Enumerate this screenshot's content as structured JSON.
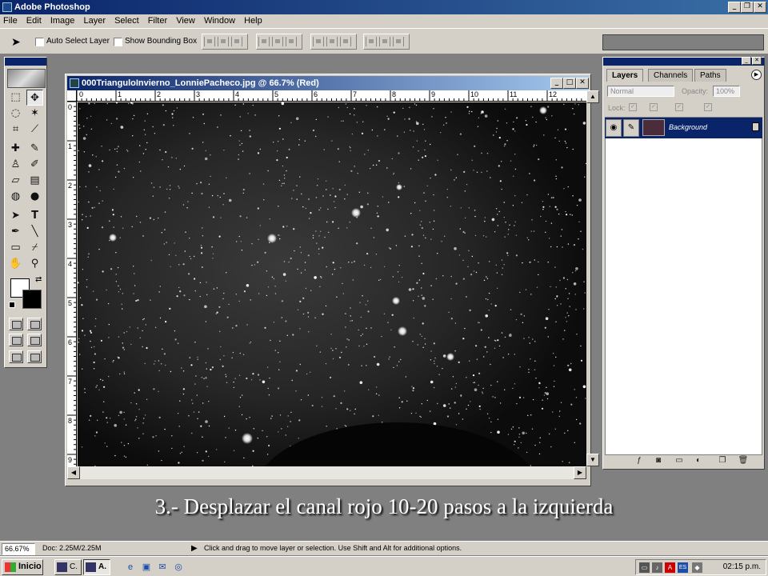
{
  "app": {
    "title": "Adobe Photoshop"
  },
  "menu": [
    "File",
    "Edit",
    "Image",
    "Layer",
    "Select",
    "Filter",
    "View",
    "Window",
    "Help"
  ],
  "options_bar": {
    "auto_select_label": "Auto Select Layer",
    "show_bounding_box_label": "Show Bounding Box"
  },
  "document": {
    "title": "000TrianguloInvierno_LonniePacheco.jpg @ 66.7% (Red)",
    "ruler_h_labels": [
      "0",
      "1",
      "2",
      "3",
      "4",
      "5",
      "6",
      "7",
      "8",
      "9",
      "10",
      "11",
      "12"
    ],
    "ruler_v_labels": [
      "0",
      "1",
      "2",
      "3",
      "4",
      "5",
      "6",
      "7",
      "8",
      "9"
    ]
  },
  "layers_panel": {
    "tabs": [
      "Layers",
      "Channels",
      "Paths"
    ],
    "blend_mode": "Normal",
    "opacity_label": "Opacity:",
    "opacity_value": "100%",
    "lock_label": "Lock:",
    "layer_name": "Background"
  },
  "caption": "3.- Desplazar el canal rojo 10-20 pasos a la izquierda",
  "status": {
    "zoom": "66.67%",
    "doc": "Doc: 2.25M/2.25M",
    "hint": "Click and drag to move layer or selection.  Use Shift and Alt for additional options."
  },
  "taskbar": {
    "start_label": "Inicio",
    "tasks": [
      "C.",
      "A."
    ],
    "tray_lang": "ES",
    "clock": "02:15 p.m."
  },
  "colors": {
    "titlebar": "#0a246a",
    "chrome": "#d4d0c8",
    "workspace": "#808080",
    "canvas": "#101010"
  },
  "icons": {
    "toolbox": [
      "marquee-icon",
      "move-icon",
      "lasso-icon",
      "magic-wand-icon",
      "crop-icon",
      "slice-icon",
      "healing-brush-icon",
      "brush-icon",
      "clone-stamp-icon",
      "history-brush-icon",
      "eraser-icon",
      "gradient-icon",
      "blur-icon",
      "dodge-icon",
      "path-select-icon",
      "type-icon",
      "pen-icon",
      "line-icon",
      "notes-icon",
      "eyedropper-icon",
      "hand-icon",
      "zoom-icon"
    ]
  }
}
